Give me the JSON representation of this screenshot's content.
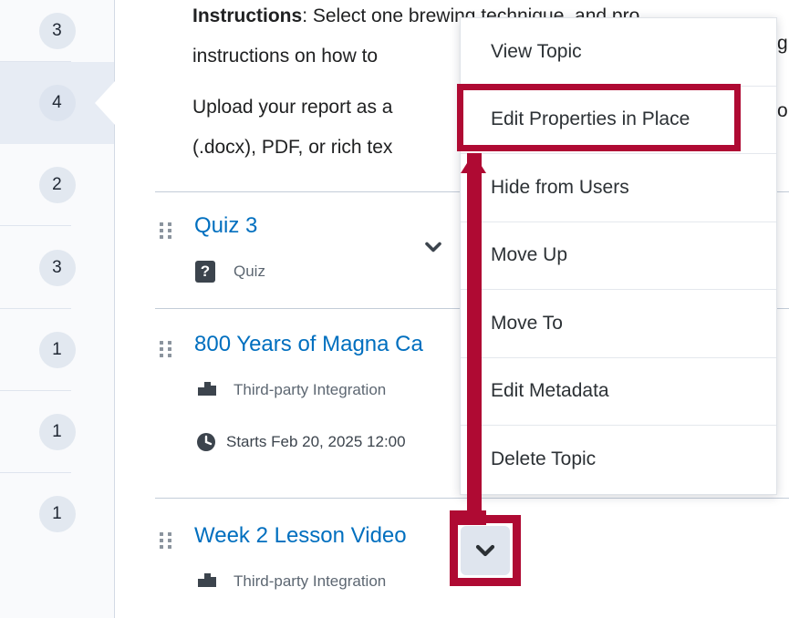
{
  "sidebar": {
    "items": [
      {
        "badge": "3",
        "selected": false
      },
      {
        "badge": "4",
        "selected": true
      },
      {
        "badge": "2",
        "selected": false
      },
      {
        "badge": "3",
        "selected": false
      },
      {
        "badge": "1",
        "selected": false
      },
      {
        "badge": "1",
        "selected": false
      },
      {
        "badge": "1",
        "selected": false
      }
    ]
  },
  "content": {
    "instructions_label": "Instructions",
    "paragraph_1": ": Select one brewing technique, and pro",
    "paragraph_1_line2": "instructions on how to",
    "paragraph_2_line1": "Upload your report as a",
    "paragraph_2_line2": "(.docx), PDF, or rich tex",
    "right_fragment_1": "g",
    "right_fragment_2": "o"
  },
  "rows": [
    {
      "title": "Quiz 3",
      "type_icon": "quiz-icon",
      "type_label": "Quiz",
      "has_chevron": true,
      "chevron_name": "chevron-down-icon"
    },
    {
      "title": "800 Years of Magna Ca",
      "type_icon": "puzzle-icon",
      "type_label": "Third-party Integration",
      "date_icon": "clock-icon",
      "date_label": "Starts Feb 20, 2025 12:00",
      "has_chevron": false
    },
    {
      "title": "Week 2 Lesson Video",
      "type_icon": "puzzle-icon",
      "type_label": "Third-party Integration",
      "has_chevron": true,
      "chevron_name": "chevron-down-icon"
    }
  ],
  "menu": {
    "items": [
      {
        "label": "View Topic",
        "highlighted": false
      },
      {
        "label": "Edit Properties in Place",
        "highlighted": true
      },
      {
        "label": "Hide from Users",
        "highlighted": false
      },
      {
        "label": "Move Up",
        "highlighted": false
      },
      {
        "label": "Move To",
        "highlighted": false
      },
      {
        "label": "Edit Metadata",
        "highlighted": false
      },
      {
        "label": "Delete Topic",
        "highlighted": false
      }
    ]
  },
  "annotation": {
    "color": "#af0a33",
    "target_label": "Edit Properties in Place",
    "source_label": "context-menu-chevron-button"
  },
  "colors": {
    "link": "#006fbf",
    "sidebar_bg": "#f9fafc",
    "sidebar_selected": "#e7ecf4",
    "badge_bg": "#e2e8f0",
    "annotation": "#af0a33"
  }
}
